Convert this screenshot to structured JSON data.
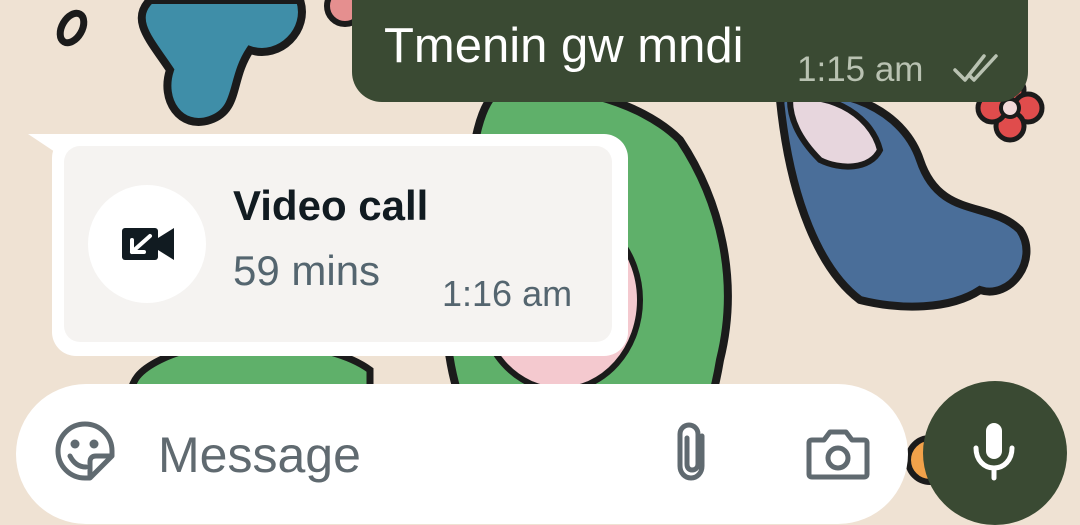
{
  "colors": {
    "wallpaper": "#efe2d3",
    "outgoing_bubble": "#3a4a33",
    "incoming_bubble": "#ffffff",
    "call_card": "#f5f3f1",
    "mic_button": "#3a4a33",
    "text_primary": "#111b21",
    "text_secondary": "#54656f"
  },
  "messages": {
    "outgoing": {
      "text": "Tmenin gw mndi",
      "time": "1:15 am",
      "status_icon": "double-check-icon"
    },
    "incoming_call": {
      "title": "Video call",
      "duration": "59 mins",
      "time": "1:16 am",
      "icon": "incoming-video-call-icon"
    }
  },
  "composer": {
    "placeholder": "Message",
    "emoji_icon": "sticker-emoji-icon",
    "attach_icon": "paperclip-icon",
    "camera_icon": "camera-icon",
    "mic_icon": "microphone-icon"
  }
}
